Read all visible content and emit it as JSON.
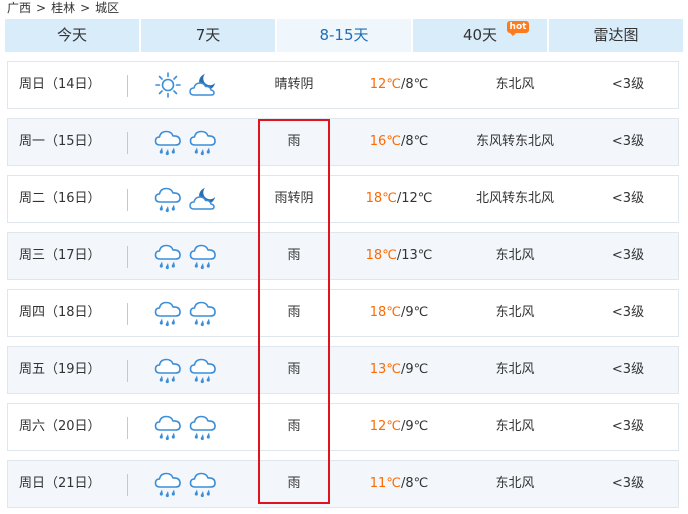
{
  "breadcrumb": {
    "items": [
      "广西",
      "桂林",
      "城区"
    ],
    "separator": ">"
  },
  "tabs": [
    {
      "label": "今天",
      "active": false
    },
    {
      "label": "7天",
      "active": false
    },
    {
      "label": "8-15天",
      "active": true
    },
    {
      "label": "40天",
      "active": false,
      "badge": "hot"
    },
    {
      "label": "雷达图",
      "active": false
    }
  ],
  "colors": {
    "accent": "#1e6eb5",
    "high_temp": "#ff6a00",
    "highlight_border": "#e0141e",
    "hot_badge": "#ff7a1a"
  },
  "forecast": [
    {
      "date": "周日（14日）",
      "icons": [
        "sun-icon",
        "cloudy-moon-icon"
      ],
      "condition": "晴转阴",
      "high": "12℃",
      "low": "/8℃",
      "wind": "东北风",
      "level": "<3级"
    },
    {
      "date": "周一（15日）",
      "icons": [
        "rain-cloud-icon",
        "rain-cloud-icon"
      ],
      "condition": "雨",
      "high": "16℃",
      "low": "/8℃",
      "wind": "东风转东北风",
      "level": "<3级"
    },
    {
      "date": "周二（16日）",
      "icons": [
        "rain-cloud-icon",
        "cloudy-moon-icon"
      ],
      "condition": "雨转阴",
      "high": "18℃",
      "low": "/12℃",
      "wind": "北风转东北风",
      "level": "<3级"
    },
    {
      "date": "周三（17日）",
      "icons": [
        "rain-cloud-icon",
        "rain-cloud-icon"
      ],
      "condition": "雨",
      "high": "18℃",
      "low": "/13℃",
      "wind": "东北风",
      "level": "<3级"
    },
    {
      "date": "周四（18日）",
      "icons": [
        "rain-cloud-icon",
        "rain-cloud-icon"
      ],
      "condition": "雨",
      "high": "18℃",
      "low": "/9℃",
      "wind": "东北风",
      "level": "<3级"
    },
    {
      "date": "周五（19日）",
      "icons": [
        "rain-cloud-icon",
        "rain-cloud-icon"
      ],
      "condition": "雨",
      "high": "13℃",
      "low": "/9℃",
      "wind": "东北风",
      "level": "<3级"
    },
    {
      "date": "周六（20日）",
      "icons": [
        "rain-cloud-icon",
        "rain-cloud-icon"
      ],
      "condition": "雨",
      "high": "12℃",
      "low": "/9℃",
      "wind": "东北风",
      "level": "<3级"
    },
    {
      "date": "周日（21日）",
      "icons": [
        "rain-cloud-icon",
        "rain-cloud-icon"
      ],
      "condition": "雨",
      "high": "11℃",
      "low": "/8℃",
      "wind": "东北风",
      "level": "<3级"
    }
  ]
}
